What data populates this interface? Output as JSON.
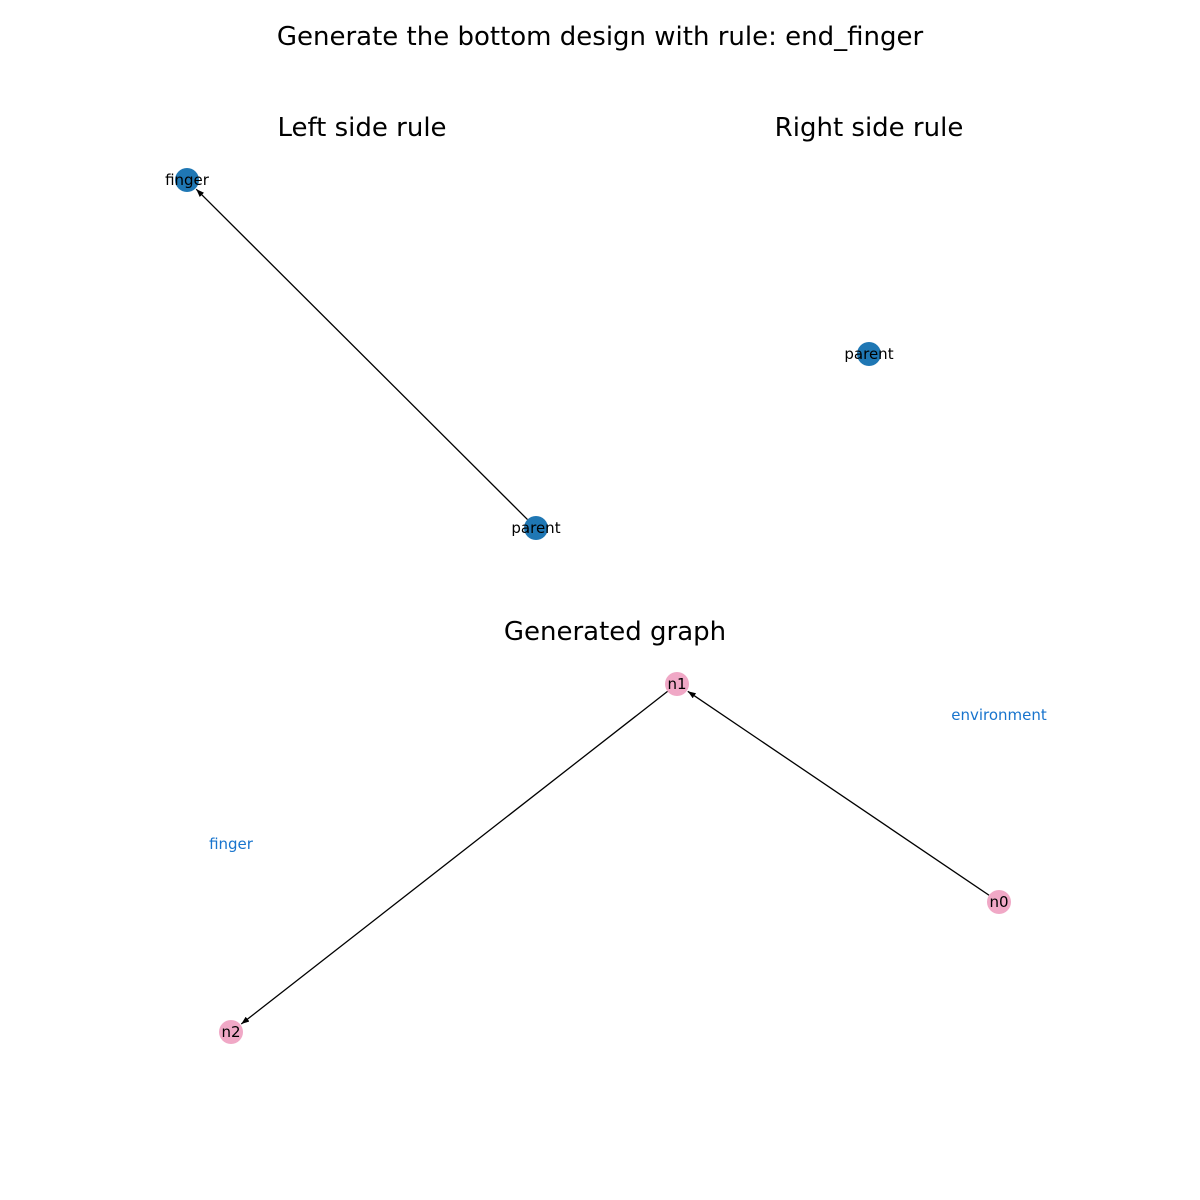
{
  "title": "Generate the bottom design with rule: end_finger",
  "left_rule": {
    "title": "Left side rule",
    "nodes": [
      {
        "id": "finger",
        "label": "finger"
      },
      {
        "id": "parent",
        "label": "parent"
      }
    ],
    "edges": [
      {
        "from": "parent",
        "to": "finger"
      }
    ]
  },
  "right_rule": {
    "title": "Right side rule",
    "nodes": [
      {
        "id": "parent",
        "label": "parent"
      }
    ],
    "edges": []
  },
  "generated": {
    "title": "Generated graph",
    "nodes": [
      {
        "id": "n1",
        "label": "n1"
      },
      {
        "id": "n0",
        "label": "n0"
      },
      {
        "id": "n2",
        "label": "n2"
      }
    ],
    "edges": [
      {
        "from": "n0",
        "to": "n1"
      },
      {
        "from": "n1",
        "to": "n2"
      }
    ],
    "annotations": [
      {
        "id": "environment",
        "text": "environment"
      },
      {
        "id": "finger",
        "text": "finger"
      }
    ]
  },
  "colors": {
    "rule_node": "#1f77b4",
    "generated_node": "#f0a8c6",
    "annotation": "#1874cd",
    "edge": "#000000"
  }
}
